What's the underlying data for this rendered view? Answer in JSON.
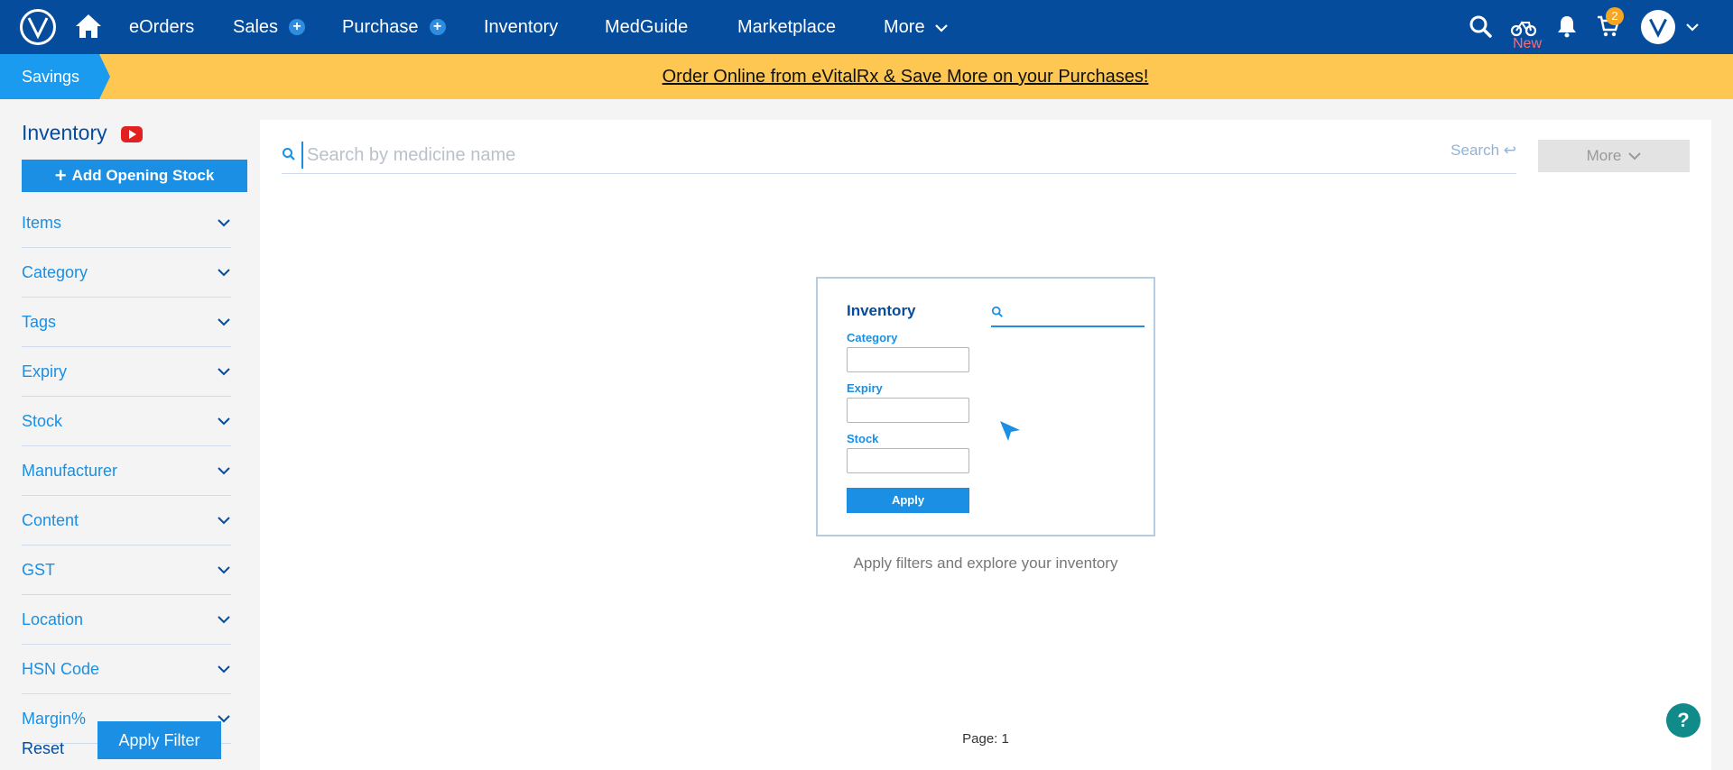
{
  "nav": {
    "links": [
      {
        "label": "eOrders"
      },
      {
        "label": "Sales"
      },
      {
        "label": "Purchase"
      },
      {
        "label": "Inventory"
      },
      {
        "label": "MedGuide"
      },
      {
        "label": "Marketplace"
      },
      {
        "label": "More"
      }
    ],
    "new_label": "New",
    "cart_count": "2",
    "icons": [
      "logo-icon",
      "home-icon",
      "search-icon",
      "bicycle-icon",
      "bell-icon",
      "cart-icon",
      "avatar-icon"
    ]
  },
  "banner": {
    "tag": "Savings",
    "link": "Order Online from eVitalRx & Save More on your Purchases!"
  },
  "sidebar": {
    "title": "Inventory",
    "add_button": "Add Opening Stock",
    "filters": [
      {
        "label": "Items"
      },
      {
        "label": "Category"
      },
      {
        "label": "Tags"
      },
      {
        "label": "Expiry"
      },
      {
        "label": "Stock"
      },
      {
        "label": "Manufacturer"
      },
      {
        "label": "Content"
      },
      {
        "label": "GST"
      },
      {
        "label": "Location"
      },
      {
        "label": "HSN Code"
      },
      {
        "label": "Margin%"
      }
    ],
    "reset": "Reset",
    "apply": "Apply Filter"
  },
  "main": {
    "search_placeholder": "Search by medicine name",
    "search_button": "Search ↩",
    "more_button": "More",
    "illustration": {
      "title": "Inventory",
      "labels": [
        "Category",
        "Expiry",
        "Stock"
      ],
      "apply": "Apply"
    },
    "caption": "Apply filters and explore your inventory",
    "page": "Page: 1",
    "help": "?"
  },
  "colors": {
    "nav_bg": "#064c9c",
    "banner_bg": "#fdc752",
    "accent": "#1a8fe3",
    "help_bg": "#118a8a"
  }
}
